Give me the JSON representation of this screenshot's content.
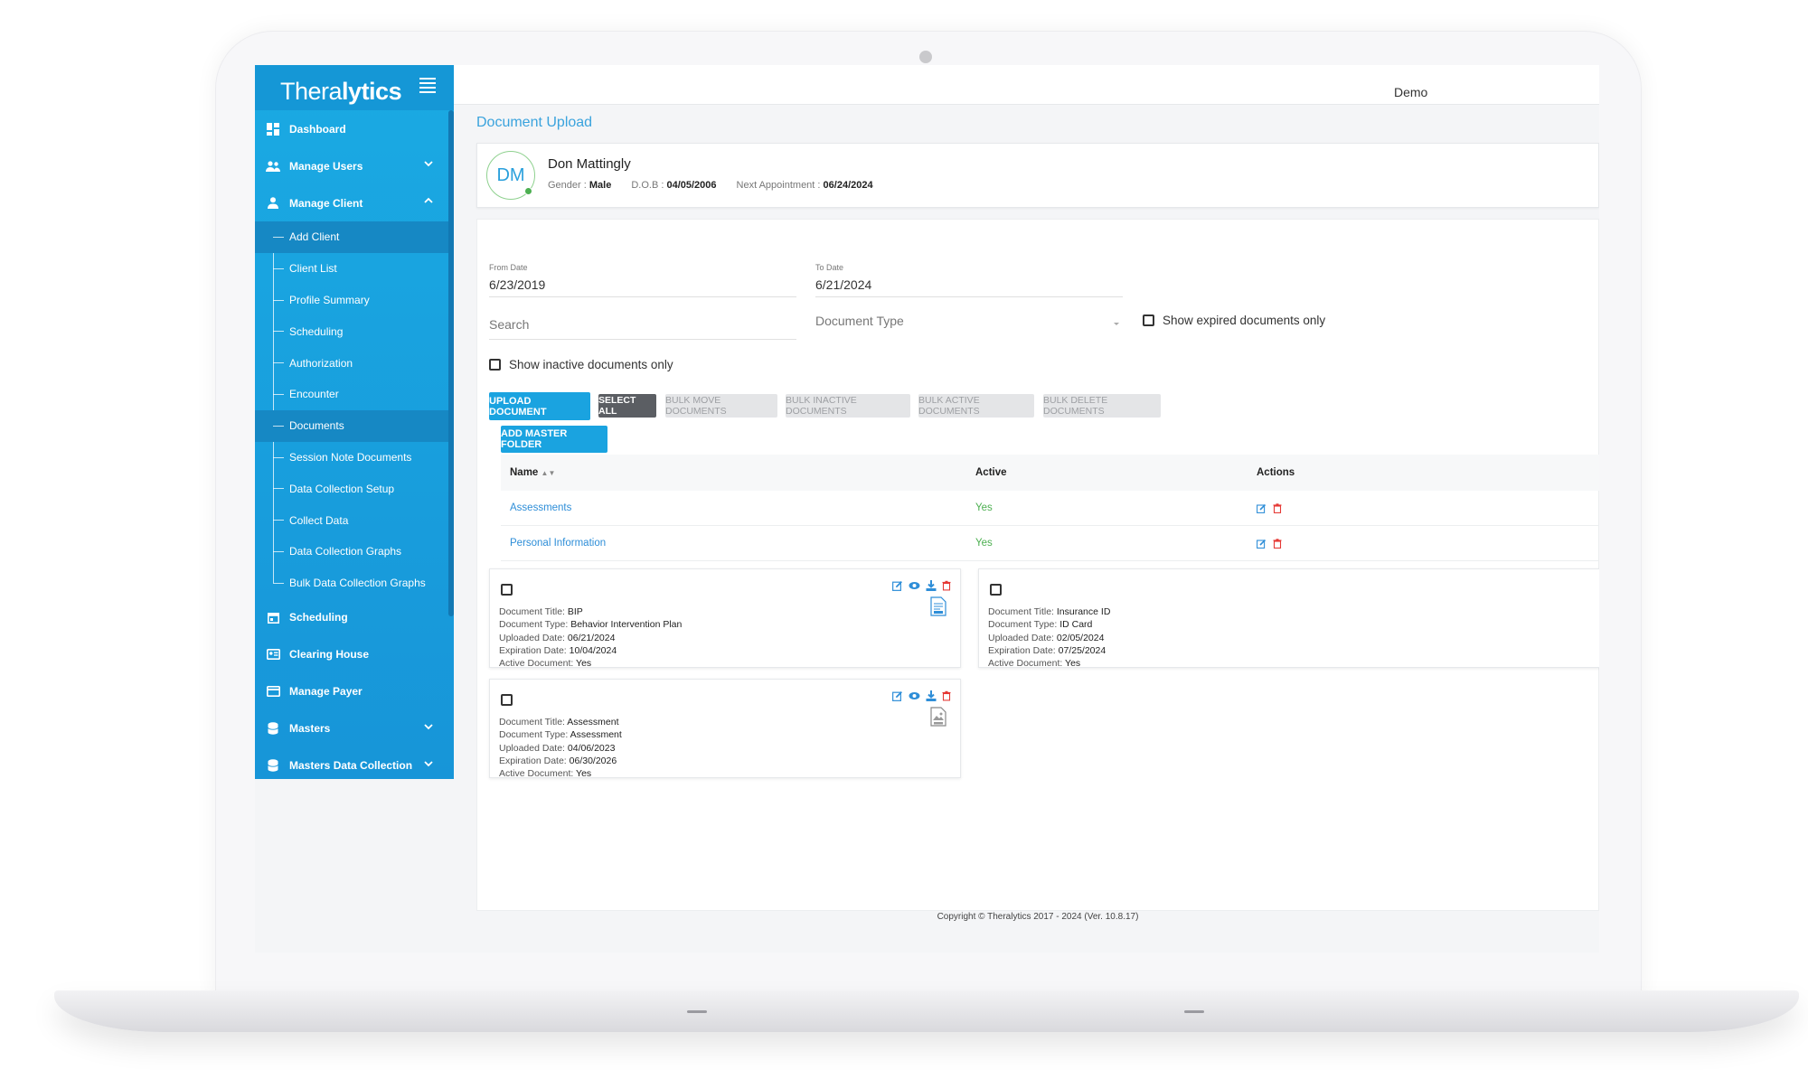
{
  "brand": {
    "name_part1": "Thera",
    "name_part2": "lytics"
  },
  "header": {
    "user": "Demo"
  },
  "sidebar": {
    "items": [
      {
        "label": "Dashboard"
      },
      {
        "label": "Manage Users"
      },
      {
        "label": "Manage Client"
      },
      {
        "label": "Scheduling"
      },
      {
        "label": "Clearing House"
      },
      {
        "label": "Manage Payer"
      },
      {
        "label": "Masters"
      },
      {
        "label": "Masters Data Collection"
      }
    ],
    "sub_items": [
      {
        "label": "Add Client"
      },
      {
        "label": "Client List"
      },
      {
        "label": "Profile Summary"
      },
      {
        "label": "Scheduling"
      },
      {
        "label": "Authorization"
      },
      {
        "label": "Encounter"
      },
      {
        "label": "Documents"
      },
      {
        "label": "Session Note Documents"
      },
      {
        "label": "Data Collection Setup"
      },
      {
        "label": "Collect Data"
      },
      {
        "label": "Data Collection Graphs"
      },
      {
        "label": "Bulk Data Collection Graphs"
      }
    ]
  },
  "page": {
    "title": "Document Upload"
  },
  "client": {
    "initials": "DM",
    "name": "Don Mattingly",
    "gender_label": "Gender :",
    "gender": "Male",
    "dob_label": "D.O.B :",
    "dob": "04/05/2006",
    "next_label": "Next Appointment :",
    "next": "06/24/2024"
  },
  "filters": {
    "from_label": "From Date",
    "from_value": "6/23/2019",
    "to_label": "To Date",
    "to_value": "6/21/2024",
    "search_placeholder": "Search",
    "doc_type_placeholder": "Document Type",
    "show_expired": "Show expired documents only",
    "show_inactive": "Show inactive documents only"
  },
  "buttons": {
    "upload": "UPLOAD DOCUMENT",
    "select_all": "SELECT ALL",
    "bulk_move": "BULK MOVE DOCUMENTS",
    "bulk_inactive": "BULK INACTIVE DOCUMENTS",
    "bulk_active": "BULK ACTIVE DOCUMENTS",
    "bulk_delete": "BULK DELETE DOCUMENTS",
    "add_folder": "ADD MASTER FOLDER"
  },
  "folders": {
    "headers": {
      "name": "Name",
      "active": "Active",
      "actions": "Actions"
    },
    "rows": [
      {
        "name": "Assessments",
        "active": "Yes"
      },
      {
        "name": "Personal Information",
        "active": "Yes"
      }
    ]
  },
  "doc_labels": {
    "title": "Document Title:",
    "type": "Document Type:",
    "uploaded": "Uploaded Date:",
    "expiration": "Expiration Date:",
    "active": "Active Document:"
  },
  "documents": [
    {
      "title": "BIP",
      "type": "Behavior Intervention Plan",
      "uploaded": "06/21/2024",
      "expiration": "10/04/2024",
      "active": "Yes"
    },
    {
      "title": "Insurance ID",
      "type": "ID Card",
      "uploaded": "02/05/2024",
      "expiration": "07/25/2024",
      "active": "Yes"
    },
    {
      "title": "Assessment",
      "type": "Assessment",
      "uploaded": "04/06/2023",
      "expiration": "06/30/2026",
      "active": "Yes"
    }
  ],
  "footer": {
    "copyright": "Copyright © Theralytics 2017 - 2024 (Ver. 10.8.17)"
  },
  "colors": {
    "primary": "#1aa3e0",
    "sidebar": "#1795d8",
    "success": "#4caf50",
    "danger": "#e53935"
  }
}
